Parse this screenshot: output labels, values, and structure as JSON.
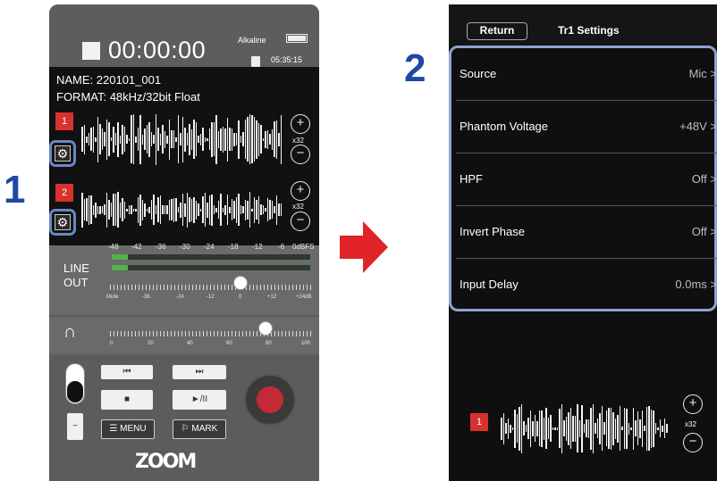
{
  "step_markers": {
    "one": "1",
    "two": "2"
  },
  "recorder": {
    "timer": "00:00:00",
    "battery_type": "Alkaline",
    "remaining_time": "05:35:15",
    "name_line": "NAME:  220101_001",
    "format_line": "FORMAT:  48kHz/32bit Float",
    "tracks": [
      {
        "number": "1",
        "zoom_label": "x32"
      },
      {
        "number": "2",
        "zoom_label": "x32"
      }
    ],
    "meter_scale": [
      "-48",
      "-42",
      "-36",
      "-30",
      "-24",
      "-18",
      "-12",
      "-6",
      "0dBFS"
    ],
    "line_out_label_1": "LINE",
    "line_out_label_2": "OUT",
    "line_out_scale": [
      "Mute",
      "-36",
      "-24",
      "-12",
      "0",
      "+12",
      "+24dB"
    ],
    "headphone_scale": [
      "0",
      "20",
      "40",
      "60",
      "80",
      "100"
    ],
    "buttons": {
      "rewind": "⏮",
      "forward": "⏭",
      "stop": "■",
      "play_pause": "►/II",
      "menu": "☰ MENU",
      "mark": "⚐ MARK"
    },
    "brand": "ZOOM",
    "colors": {
      "track_red": "#d8312e",
      "highlight_blue": "#6a86c4",
      "meter_green": "#55b24a"
    }
  },
  "settings_screen": {
    "return_label": "Return",
    "title": "Tr1 Settings",
    "rows": [
      {
        "label": "Source",
        "value": "Mic >"
      },
      {
        "label": "Phantom Voltage",
        "value": "+48V >"
      },
      {
        "label": "HPF",
        "value": "Off >"
      },
      {
        "label": "Invert Phase",
        "value": "Off >"
      },
      {
        "label": "Input Delay",
        "value": "0.0ms >"
      }
    ],
    "track_number": "1",
    "zoom_label": "x32"
  }
}
